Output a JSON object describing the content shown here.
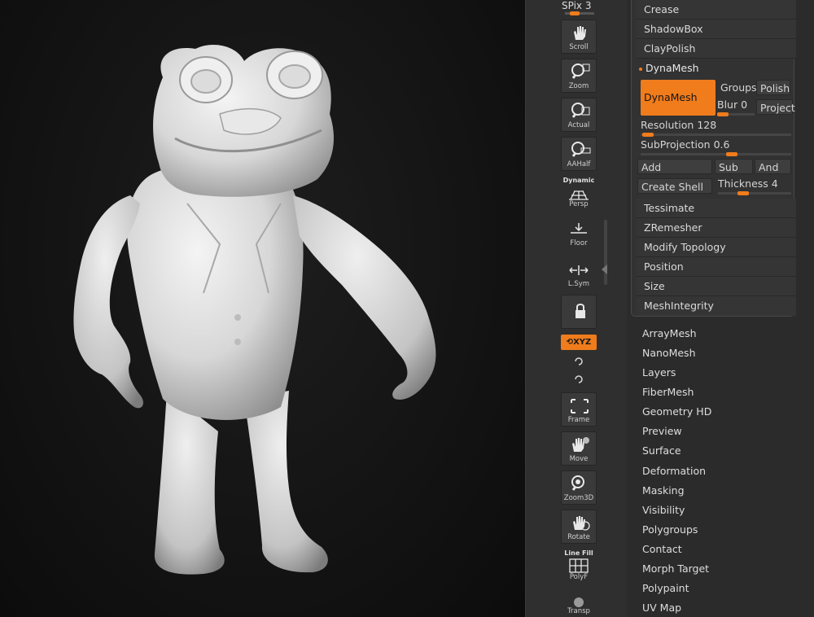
{
  "shelf": {
    "spix_label": "SPix",
    "spix_value": "3",
    "tools": [
      {
        "name": "scroll",
        "label": "Scroll"
      },
      {
        "name": "zoom",
        "label": "Zoom"
      },
      {
        "name": "actual",
        "label": "Actual"
      },
      {
        "name": "aahalf",
        "label": "AAHalf"
      },
      {
        "name": "persp",
        "label": "Persp",
        "top": "Dynamic"
      },
      {
        "name": "floor",
        "label": "Floor"
      },
      {
        "name": "lsym",
        "label": "L.Sym"
      },
      {
        "name": "lock",
        "label": ""
      },
      {
        "name": "frame",
        "label": "Frame"
      },
      {
        "name": "move",
        "label": "Move"
      },
      {
        "name": "zoom3d",
        "label": "Zoom3D"
      },
      {
        "name": "rotate",
        "label": "Rotate"
      },
      {
        "name": "polyf",
        "label": "PolyF",
        "top": "Line Fill"
      },
      {
        "name": "transp",
        "label": "Transp"
      }
    ],
    "xyz_label": "XYZ"
  },
  "geometry_panel": {
    "rows_top": [
      "Crease",
      "ShadowBox",
      "ClayPolish"
    ],
    "dynamesh_header": "DynaMesh",
    "dynamesh_button": "DynaMesh",
    "groups": "Groups",
    "polish": "Polish",
    "blur_label": "Blur",
    "blur_value": "0",
    "project": "Project",
    "resolution_label": "Resolution",
    "resolution_value": "128",
    "subprojection_label": "SubProjection",
    "subprojection_value": "0.6",
    "add": "Add",
    "sub": "Sub",
    "and": "And",
    "create_shell": "Create Shell",
    "thickness_label": "Thickness",
    "thickness_value": "4",
    "rows_bottom": [
      "Tessimate",
      "ZRemesher",
      "Modify Topology",
      "Position",
      "Size",
      "MeshIntegrity"
    ]
  },
  "tool_menu": [
    "ArrayMesh",
    "NanoMesh",
    "Layers",
    "FiberMesh",
    "Geometry HD",
    "Preview",
    "Surface",
    "Deformation",
    "Masking",
    "Visibility",
    "Polygroups",
    "Contact",
    "Morph Target",
    "Polypaint",
    "UV Map"
  ],
  "colors": {
    "accent": "#f07c1c",
    "mesh": "#e6e6e6"
  }
}
